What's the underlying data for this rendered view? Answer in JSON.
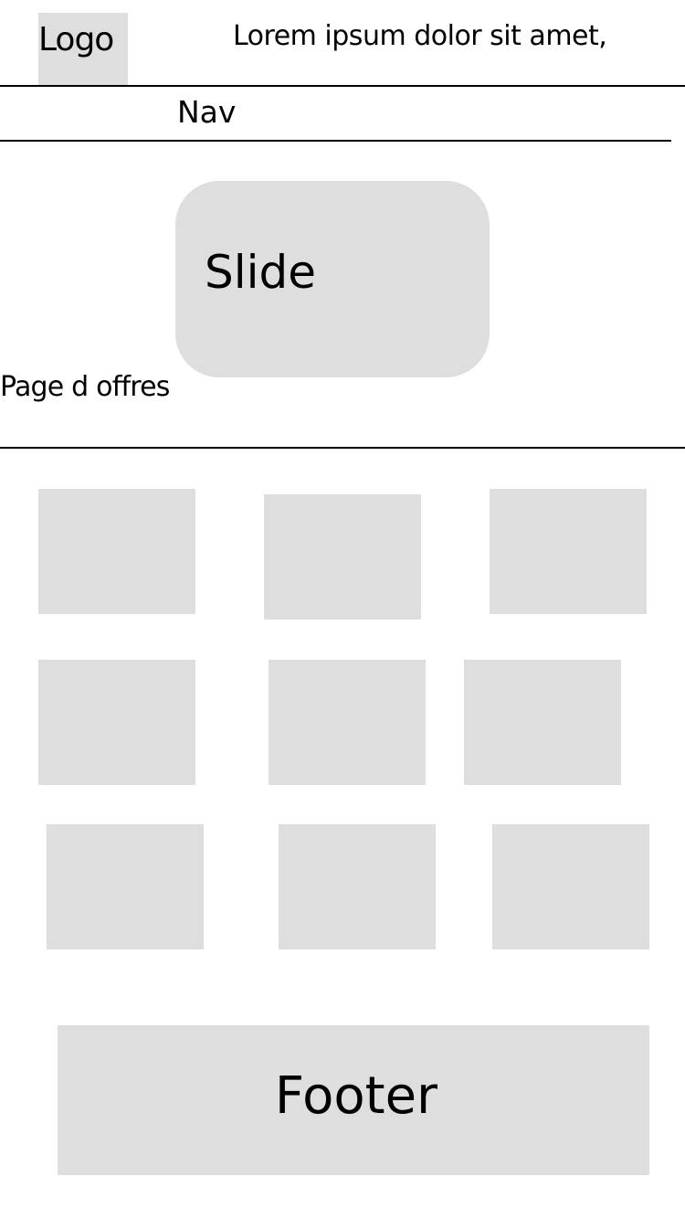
{
  "header": {
    "logo_label": "Logo",
    "tagline": "Lorem ipsum dolor sit amet,"
  },
  "nav": {
    "label": "Nav"
  },
  "hero": {
    "slide_label": "Slide"
  },
  "offers": {
    "title": "Page d offres",
    "items": [
      {
        "id": 1
      },
      {
        "id": 2
      },
      {
        "id": 3
      },
      {
        "id": 4
      },
      {
        "id": 5
      },
      {
        "id": 6
      },
      {
        "id": 7
      },
      {
        "id": 8
      },
      {
        "id": 9
      }
    ]
  },
  "footer": {
    "label": "Footer"
  },
  "colors": {
    "placeholder": "#dedede",
    "rule": "#000000",
    "text": "#000000",
    "background": "#ffffff"
  }
}
